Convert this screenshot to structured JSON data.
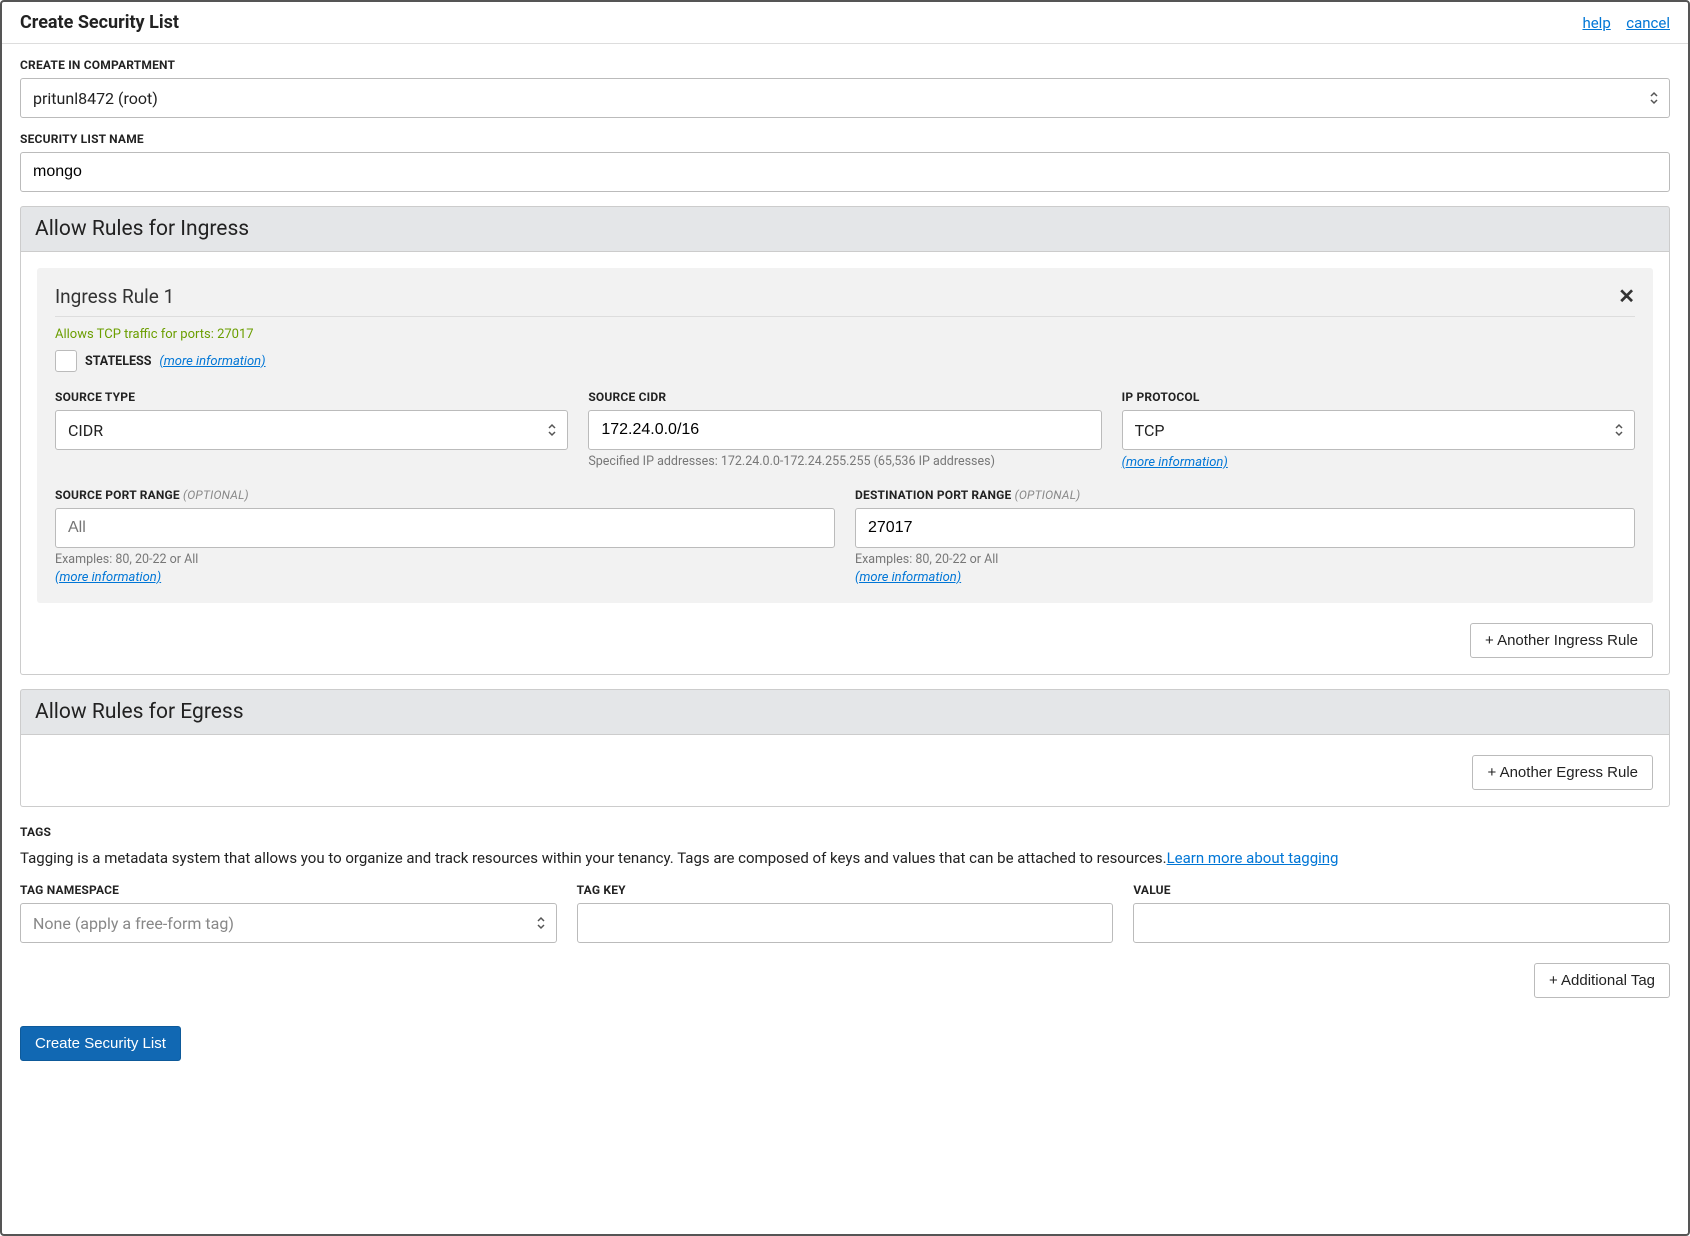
{
  "header": {
    "title": "Create Security List",
    "help": "help",
    "cancel": "cancel"
  },
  "compartment": {
    "label": "CREATE IN COMPARTMENT",
    "value": "pritunl8472 (root)"
  },
  "name": {
    "label": "SECURITY LIST NAME",
    "value": "mongo"
  },
  "ingress": {
    "header": "Allow Rules for Ingress",
    "rule_title": "Ingress Rule 1",
    "summary": "Allows TCP traffic for ports: 27017",
    "stateless_label": "STATELESS",
    "more_info": "(more information)",
    "source_type_label": "SOURCE TYPE",
    "source_type_value": "CIDR",
    "source_cidr_label": "SOURCE CIDR",
    "source_cidr_value": "172.24.0.0/16",
    "cidr_hint": "Specified IP addresses: 172.24.0.0-172.24.255.255 (65,536 IP addresses)",
    "ip_protocol_label": "IP PROTOCOL",
    "ip_protocol_value": "TCP",
    "source_port_label": "SOURCE PORT RANGE",
    "dest_port_label": "DESTINATION PORT RANGE",
    "optional": "(OPTIONAL)",
    "source_port_placeholder": "All",
    "dest_port_value": "27017",
    "port_examples": "Examples: 80, 20-22 or All",
    "add_button": "+ Another Ingress Rule"
  },
  "egress": {
    "header": "Allow Rules for Egress",
    "add_button": "+ Another Egress Rule"
  },
  "tags": {
    "heading": "TAGS",
    "desc": "Tagging is a metadata system that allows you to organize and track resources within your tenancy. Tags are composed of keys and values that can be attached to resources.",
    "learn_more": "Learn more about tagging",
    "namespace_label": "TAG NAMESPACE",
    "namespace_placeholder": "None (apply a free-form tag)",
    "key_label": "TAG KEY",
    "value_label": "VALUE",
    "add_button": "+ Additional Tag"
  },
  "footer": {
    "submit": "Create Security List"
  }
}
